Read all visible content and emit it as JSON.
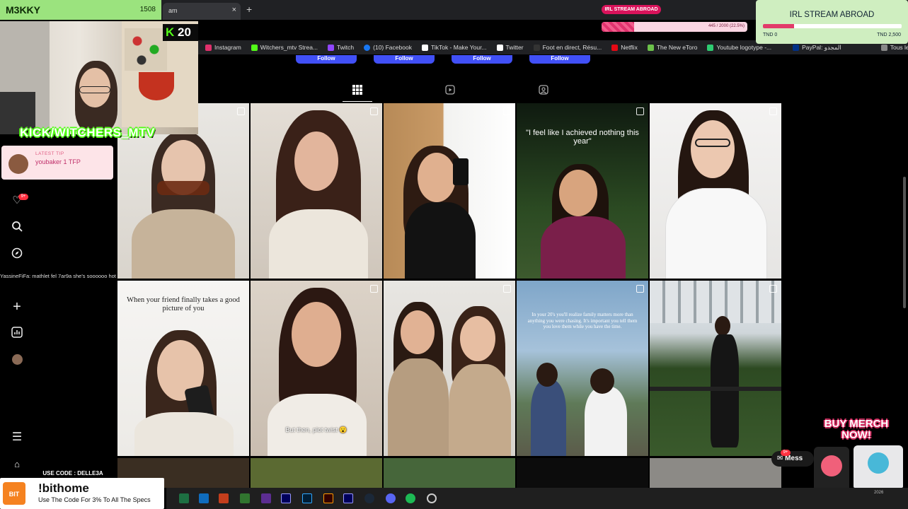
{
  "browser": {
    "tab_title": "am",
    "bookmarks": [
      {
        "label": "Instagram",
        "color": "#e1306c"
      },
      {
        "label": "Witchers_mtv Strea...",
        "color": "#53fc18"
      },
      {
        "label": "Twitch",
        "color": "#9146ff"
      },
      {
        "label": "(10) Facebook",
        "color": "#1877f2"
      },
      {
        "label": "TikTok - Make Your...",
        "color": "#ffffff"
      },
      {
        "label": "Twitter",
        "color": "#ffffff"
      },
      {
        "label": "Foot en direct, Résu...",
        "color": "#333333"
      },
      {
        "label": "Netflix",
        "color": "#e50914"
      },
      {
        "label": "The New eToro",
        "color": "#6cc24a"
      },
      {
        "label": "Youtube logotype -...",
        "color": "#2ecc71"
      },
      {
        "label": "PayPal: المجدو",
        "color": "#003087"
      },
      {
        "label": "Tous les favoris",
        "color": "#888888"
      }
    ]
  },
  "instagram": {
    "follow_label": "Follow",
    "tabs": [
      "grid-icon",
      "reels-icon",
      "tagged-icon"
    ],
    "posts": [
      {
        "caption": ""
      },
      {
        "caption": ""
      },
      {
        "caption": ""
      },
      {
        "caption": "\"I feel like I achieved nothing this year\""
      },
      {
        "caption": ""
      },
      {
        "caption": "When your friend finally takes a good picture of you"
      },
      {
        "caption": "But then, plot twist 😮"
      },
      {
        "caption": ""
      },
      {
        "caption": "In your 20's you'll realize family matters more than anything you were chasing. It's important you tell them you love them while you have the time."
      },
      {
        "caption": ""
      }
    ]
  },
  "stream": {
    "streamer_name": "M3KKY",
    "viewer_count": "1508",
    "kick_count": "20",
    "kick_channel": "KICK/WITCHERS_MTV",
    "latest_tip_label": "LATEST TIP",
    "latest_tip_value": "youbaker 1 TFP",
    "chat_message": "YassineFiFa: mathlet fel 7ar9a she's soooooo hot",
    "goal_pill": "IRL STREAM ABROAD",
    "goal_title": "IRL STREAM ABROAD",
    "goal_min": "TND 0",
    "goal_max": "TND 2,500",
    "goal_progress_text": "445 / 2000 (22.5%)",
    "goal_fraction": 0.225,
    "merch_text": "BUY MERCH NOW!",
    "messages_label": "Mess",
    "messages_badge": "9+",
    "notif_badge": "9+",
    "promo_code_bar": "USE CODE : DELLE3A",
    "promo_title": "!bithome",
    "promo_sub": "Use The Code For 3% To All The Specs",
    "promo_logo": "BIT"
  },
  "taskbar": {
    "date": "2026"
  }
}
